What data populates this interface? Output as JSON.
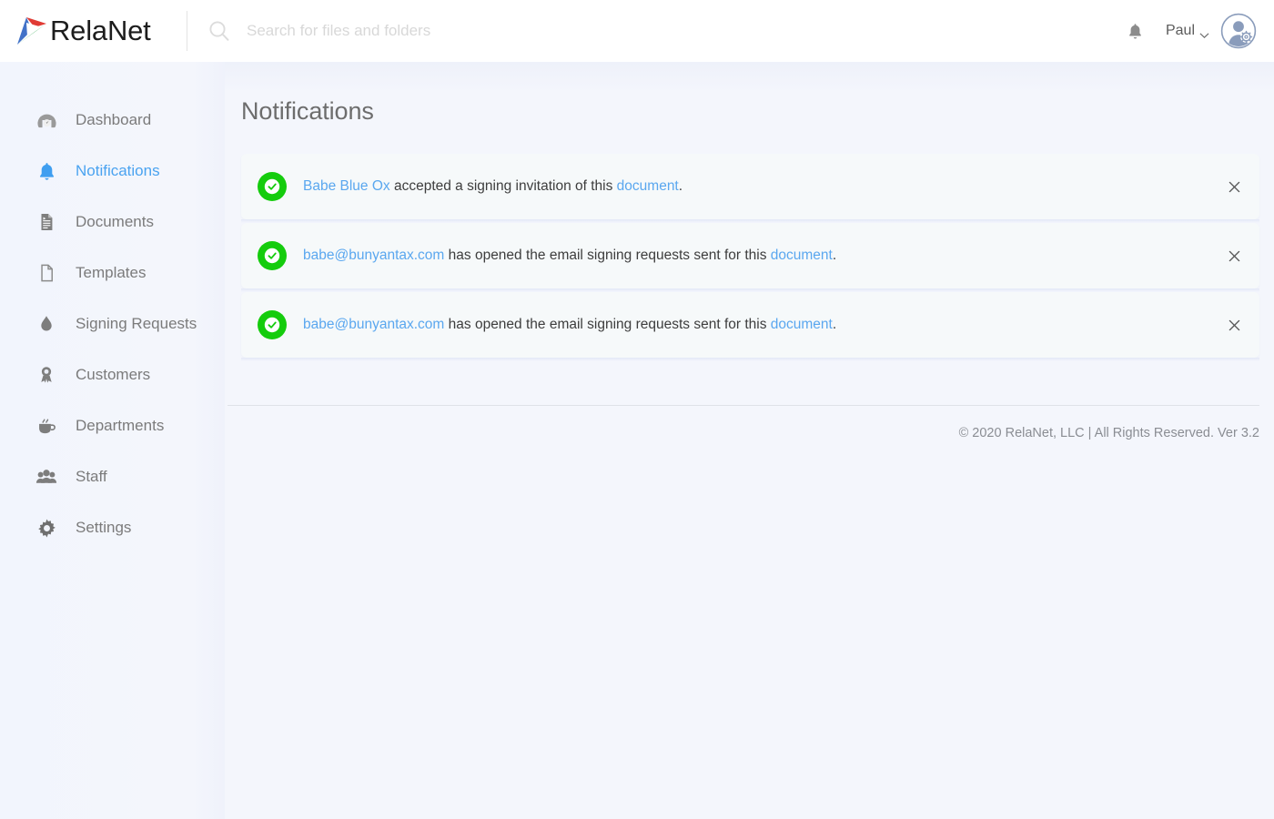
{
  "brand": {
    "name": "RelaNet",
    "logo_icon": "relanet-triangle-logo",
    "colors": {
      "red": "#e03b34",
      "blue": "#4272c8",
      "green": "#32a852"
    }
  },
  "search": {
    "icon": "search-icon",
    "value": "",
    "placeholder": "Search for files and folders"
  },
  "header": {
    "bell_icon": "bell-icon",
    "user_name": "Paul",
    "chevron_icon": "chevron-down-icon",
    "avatar_icon": "user-avatar-with-gear-icon"
  },
  "sidebar": {
    "items": [
      {
        "label": "Dashboard",
        "icon": "dashboard-gauge-icon",
        "active": false
      },
      {
        "label": "Notifications",
        "icon": "bell-icon",
        "active": true
      },
      {
        "label": "Documents",
        "icon": "document-lines-icon",
        "active": false
      },
      {
        "label": "Templates",
        "icon": "blank-page-icon",
        "active": false
      },
      {
        "label": "Signing Requests",
        "icon": "droplet-icon",
        "active": false
      },
      {
        "label": "Customers",
        "icon": "award-medal-icon",
        "active": false
      },
      {
        "label": "Departments",
        "icon": "coffee-cup-icon",
        "active": false
      },
      {
        "label": "Staff",
        "icon": "people-group-icon",
        "active": false
      },
      {
        "label": "Settings",
        "icon": "gear-icon",
        "active": false
      }
    ]
  },
  "main": {
    "title": "Notifications",
    "accent_color": "#4aa3f0",
    "success_color": "#15cc0d",
    "close_icon": "close-icon",
    "status_icon": "check-circle-icon",
    "notifications": [
      {
        "link1": "Babe Blue Ox",
        "middle": " accepted a signing invitation of this ",
        "link2": "document",
        "tail": "."
      },
      {
        "link1": "babe@bunyantax.com",
        "middle": " has opened the email signing requests sent for this ",
        "link2": "document",
        "tail": "."
      },
      {
        "link1": "babe@bunyantax.com",
        "middle": " has opened the email signing requests sent for this ",
        "link2": "document",
        "tail": "."
      }
    ]
  },
  "footer": {
    "text": "© 2020 RelaNet, LLC | All Rights Reserved. Ver 3.2"
  }
}
